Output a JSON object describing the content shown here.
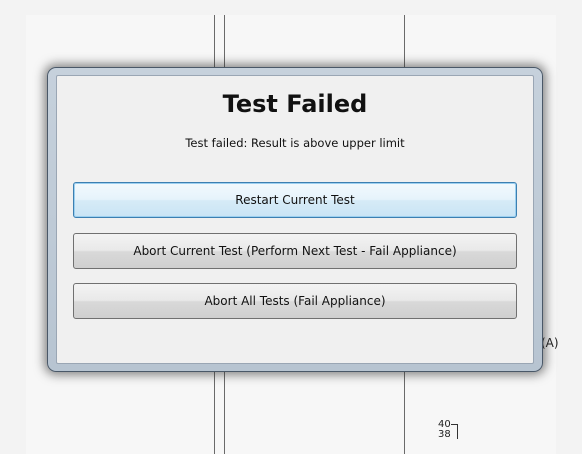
{
  "background": {
    "side_label": "(A)",
    "axis_ticks": [
      "40",
      "38"
    ]
  },
  "dialog": {
    "title": "Test Failed",
    "message": "Test failed: Result is above upper limit",
    "buttons": [
      {
        "label": "Restart Current Test",
        "focused": true
      },
      {
        "label": "Abort Current Test (Perform Next Test - Fail Appliance)",
        "focused": false
      },
      {
        "label": "Abort All Tests (Fail Appliance)",
        "focused": false
      }
    ]
  },
  "colors": {
    "focus_border": "#3c7fb1",
    "frame": "#b7c4d1"
  }
}
